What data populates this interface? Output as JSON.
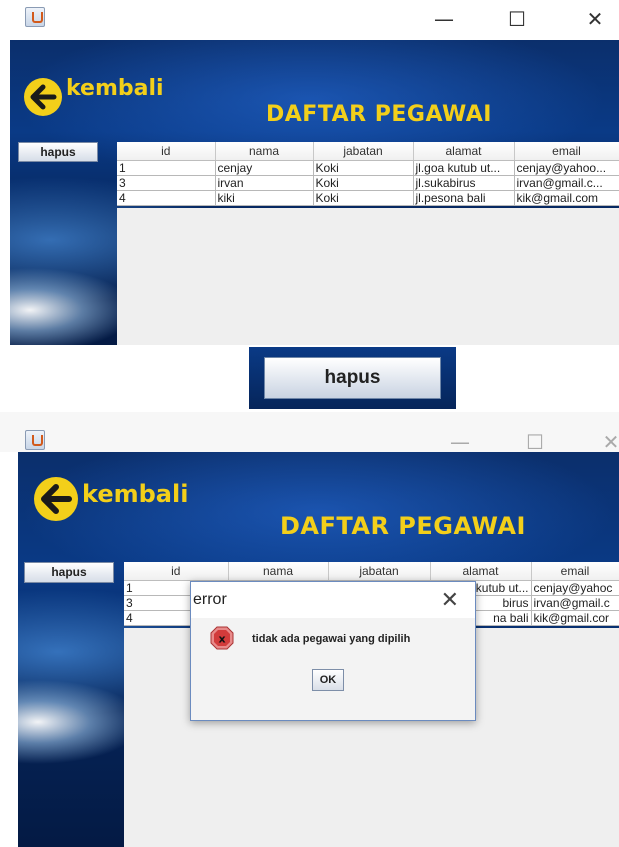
{
  "top": {
    "window": {
      "minimize_glyph": "—",
      "maximize_glyph": "☐",
      "close_glyph": "✕",
      "icon": "java-app-icon"
    },
    "back_label": "kembali",
    "heading": "DAFTAR PEGAWAI",
    "hapus_label": "hapus",
    "columns": [
      "id",
      "nama",
      "jabatan",
      "alamat",
      "email"
    ],
    "rows": [
      [
        "1",
        "cenjay",
        "Koki",
        "jl.goa kutub ut...",
        "cenjay@yahoo..."
      ],
      [
        "3",
        "irvan",
        "Koki",
        "jl.sukabirus",
        "irvan@gmail.c..."
      ],
      [
        "4",
        "kiki",
        "Koki",
        "jl.pesona bali",
        "kik@gmail.com"
      ]
    ]
  },
  "middle": {
    "hapus_label": "hapus"
  },
  "bottom": {
    "window": {
      "minimize_glyph": "—",
      "maximize_glyph": "☐",
      "close_glyph": "✕",
      "icon": "java-app-icon"
    },
    "back_label": "kembali",
    "heading": "DAFTAR PEGAWAI",
    "hapus_label": "hapus",
    "columns": [
      "id",
      "nama",
      "jabatan",
      "alamat",
      "email"
    ],
    "rows": [
      [
        "1",
        "",
        "",
        "kutub ut...",
        "cenjay@yahoc"
      ],
      [
        "3",
        "",
        "",
        "birus",
        "irvan@gmail.c"
      ],
      [
        "4",
        "",
        "",
        "na bali",
        "kik@gmail.cor"
      ]
    ],
    "dialog": {
      "title": "error",
      "close_glyph": "✕",
      "icon": "error-x-icon",
      "message": "tidak ada pegawai yang dipilih",
      "ok_label": "OK"
    }
  },
  "colors": {
    "accent_yellow": "#f3cf1a",
    "panel_blue": "#0a3a86",
    "error_red": "#d23b3b"
  }
}
